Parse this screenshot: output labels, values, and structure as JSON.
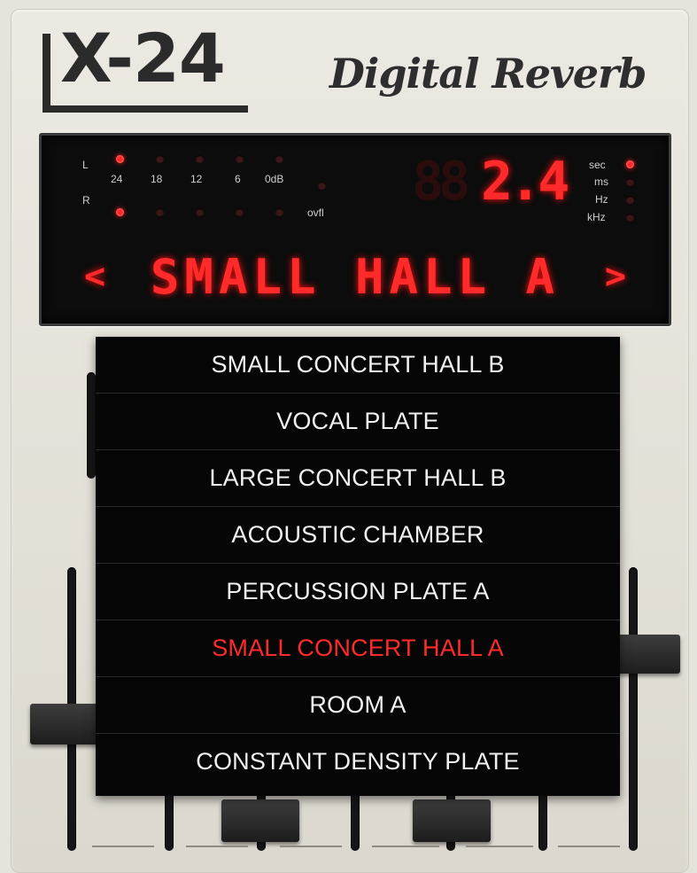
{
  "header": {
    "logo": "LX-24",
    "logo_text": "X-24",
    "tagline": "Digital Reverb"
  },
  "meter": {
    "channel_left": "L",
    "channel_right": "R",
    "scale": [
      "24",
      "18",
      "12",
      "6",
      "0dB"
    ],
    "ovfl_label": "ovfl",
    "left_lit": [
      "24"
    ],
    "right_lit": [
      "24"
    ]
  },
  "readout": {
    "value": "2.4",
    "units": [
      "sec",
      "ms",
      "Hz",
      "kHz"
    ],
    "active_unit": "sec"
  },
  "preset_display": {
    "prev_arrow": "<",
    "name": "SMALL HALL A",
    "next_arrow": ">"
  },
  "preset_menu": {
    "items": [
      "SMALL CONCERT HALL B",
      "VOCAL PLATE",
      "LARGE CONCERT HALL B",
      "ACOUSTIC CHAMBER",
      "PERCUSSION PLATE A",
      "SMALL CONCERT HALL A",
      "ROOM A",
      "CONSTANT DENSITY PLATE"
    ],
    "selected_index": 5
  },
  "colors": {
    "led_red": "#ff2a2a",
    "panel": "#e6e3dc",
    "display_bg": "#0c0c0c",
    "menu_bg": "#060606"
  }
}
